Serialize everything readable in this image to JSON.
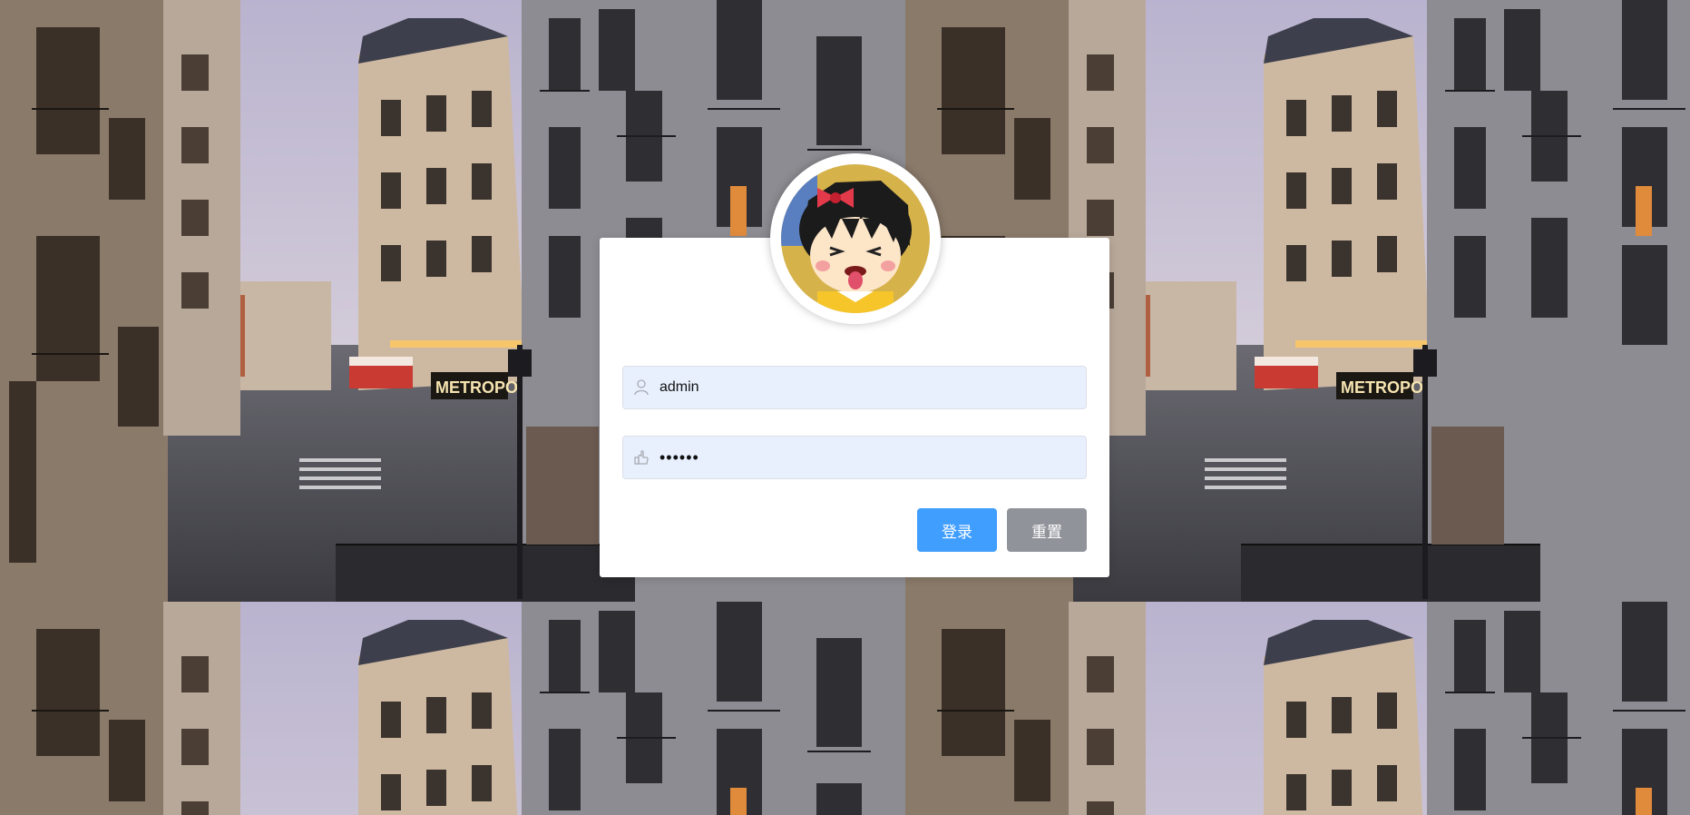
{
  "login_form": {
    "username_value": "admin",
    "username_icon": "user-icon",
    "password_value": "123456",
    "password_icon": "lock-hand-icon",
    "login_label": "登录",
    "reset_label": "重置"
  },
  "avatar": {
    "icon": "cartoon-girl-avatar"
  },
  "colors": {
    "primary": "#409eff",
    "info": "#909399",
    "input_bg": "#e8f0fe"
  }
}
